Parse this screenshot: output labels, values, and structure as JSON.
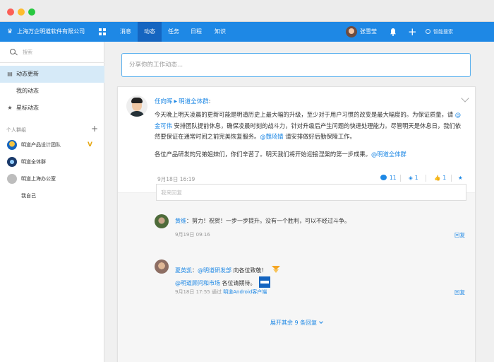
{
  "brand": {
    "name": "上海万企明道软件有限公司"
  },
  "nav": {
    "tabs": [
      "消息",
      "动态",
      "任务",
      "日程",
      "知识"
    ],
    "active": "动态"
  },
  "user": {
    "name": "张雪莹"
  },
  "top_search": {
    "placeholder": "智能搜索"
  },
  "sidebar": {
    "search_placeholder": "搜索",
    "items": [
      {
        "label": "动态更新",
        "icon": "feed-icon",
        "active": true
      },
      {
        "label": "我的动态",
        "icon": "",
        "active": false
      },
      {
        "label": "星标动态",
        "icon": "star-icon",
        "active": false
      }
    ],
    "group_header": "个人群组",
    "groups": [
      {
        "label": "明道产品设计团队",
        "badge": "V"
      },
      {
        "label": "明道全体群",
        "badge": ""
      },
      {
        "label": "明道上海办公室",
        "badge": ""
      },
      {
        "label": "我自己",
        "badge": ""
      }
    ]
  },
  "composer": {
    "placeholder": "分享你的工作动态..."
  },
  "post": {
    "author": "任向晖",
    "group": "明道全体群",
    "colon": ":",
    "p1_a": "今天晚上明天凌晨的更新可能是明道历史上最大幅的升级，至少对于用户习惯的改变是最大幅度的。为保证质量，请 ",
    "p1_m1": "@金可伟",
    "p1_b": " 安排团队提前休息，确保凌晨时刻的战斗力，针对升级后产生问题的快速处理能力。尽管明天是休息日，我们依然要保证在通常时间之前完美恢复服务。",
    "p1_m2": "@魏琦婧",
    "p1_c": " 请安排做好后勤保障工作。",
    "p2_a": "各位产品研发的兄弟姐妹们，你们辛苦了。明天我们将开始迎接涅槃的第一步成果。",
    "p2_m": "@明道全体群",
    "time": "9月18日 16:19",
    "comment_count": "11",
    "tag_count": "1",
    "like_count": "1"
  },
  "reply_box": {
    "placeholder": "我来回复"
  },
  "comments": [
    {
      "name": "黄维",
      "text": "努力！祝贺！一步一步提升。没有一个胜利，可以不经过斗争。",
      "time": "9月19日 09:16",
      "via": "",
      "source": "",
      "reply": "回复"
    },
    {
      "name": "夏英凯",
      "mention1": "@明道研发部",
      "text1": " 向各位致敬！",
      "mention2": "@明道顾问和市场",
      "text2": " 各位请期待。",
      "time": "9月18日 17:55",
      "via": "通过",
      "source": "明道Android客户端",
      "reply": "回复"
    }
  ],
  "expand": {
    "label": "展开其余 9 条回复"
  }
}
